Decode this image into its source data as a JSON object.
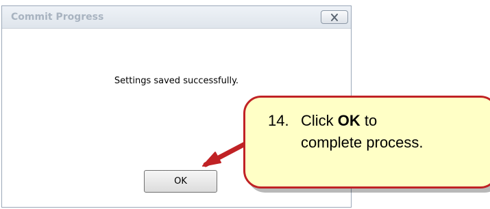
{
  "dialog": {
    "title": "Commit Progress",
    "close_icon": "close-x-icon",
    "message": "Settings saved successfully.",
    "ok_label": "OK"
  },
  "callout": {
    "step": "14.",
    "before": "Click ",
    "emphasis": "OK",
    "after": " to",
    "line2": "complete process.",
    "fill_color": "#ffffc6",
    "border_color": "#c02225",
    "arrow_color": "#c02225"
  }
}
